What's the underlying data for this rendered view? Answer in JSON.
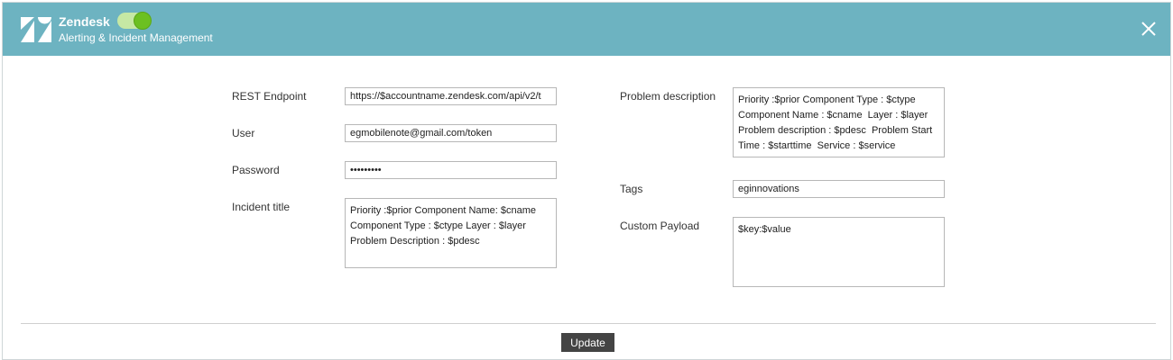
{
  "header": {
    "app_name": "Zendesk",
    "subtitle": "Alerting & Incident Management",
    "toggle_state": "on",
    "logo_icon": "zendesk-logo-icon",
    "close_icon": "close-icon",
    "colors": {
      "header_bg": "#6db3c1",
      "toggle_on": "#6cc021"
    }
  },
  "form": {
    "rest_endpoint": {
      "label": "REST Endpoint",
      "value": "https://$accountname.zendesk.com/api/v2/t"
    },
    "user": {
      "label": "User",
      "value": "egmobilenote@gmail.com/token"
    },
    "password": {
      "label": "Password",
      "value": "•••••••••"
    },
    "incident_title": {
      "label": "Incident title",
      "value": "Priority :$prior Component Name: $cname\nComponent Type : $ctype Layer : $layer\nProblem Description : $pdesc"
    },
    "problem_description": {
      "label": "Problem description",
      "value": "Priority :$prior Component Type : $ctype\nComponent Name : $cname  Layer : $layer\nProblem description : $pdesc  Problem Start\nTime : $starttime  Service : $service"
    },
    "tags": {
      "label": "Tags",
      "value": "eginnovations"
    },
    "custom_payload": {
      "label": "Custom Payload",
      "value": "$key:$value"
    }
  },
  "footer": {
    "update_label": "Update"
  }
}
